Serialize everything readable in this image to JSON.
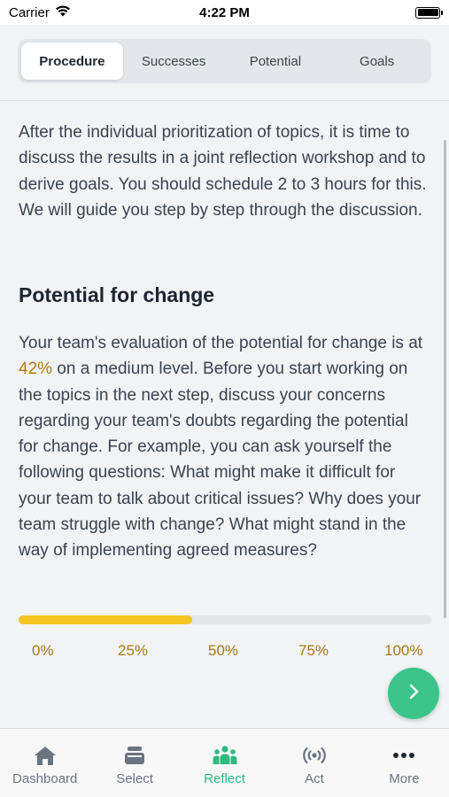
{
  "status_bar": {
    "carrier": "Carrier",
    "time": "4:22 PM"
  },
  "segments": [
    {
      "label": "Procedure",
      "active": true
    },
    {
      "label": "Successes",
      "active": false
    },
    {
      "label": "Potential",
      "active": false
    },
    {
      "label": "Goals",
      "active": false
    }
  ],
  "intro_text": "After the individual prioritization of topics, it is time to discuss the results in a joint reflection workshop and to derive goals. You should schedule 2 to 3 hours for this. We will guide you step by step through the discussion.",
  "section": {
    "title": "Potential for change",
    "text_before": "Your team's evaluation of the potential for change is at ",
    "percent": "42%",
    "text_after": " on a medium level. Before you start working on the topics in the next step, discuss your concerns regarding your team's doubts regarding the potential for change. For example, you can ask yourself the following questions: What might make it difficult for your team to talk about critical issues? Why does your team struggle with change? What might stand in the way of implementing agreed measures?"
  },
  "progress": {
    "value": 0.42,
    "ticks": [
      "0%",
      "25%",
      "50%",
      "75%",
      "100%"
    ]
  },
  "colors": {
    "accent": "#3cc48a",
    "progress": "#f4c520",
    "highlight": "#b07a12"
  },
  "fab": {
    "icon": "chevron-right-icon"
  },
  "tabbar": {
    "items": [
      {
        "label": "Dashboard",
        "icon": "home-icon"
      },
      {
        "label": "Select",
        "icon": "stack-icon"
      },
      {
        "label": "Reflect",
        "icon": "team-icon"
      },
      {
        "label": "Act",
        "icon": "broadcast-icon"
      },
      {
        "label": "More",
        "icon": "more-icon"
      }
    ]
  }
}
